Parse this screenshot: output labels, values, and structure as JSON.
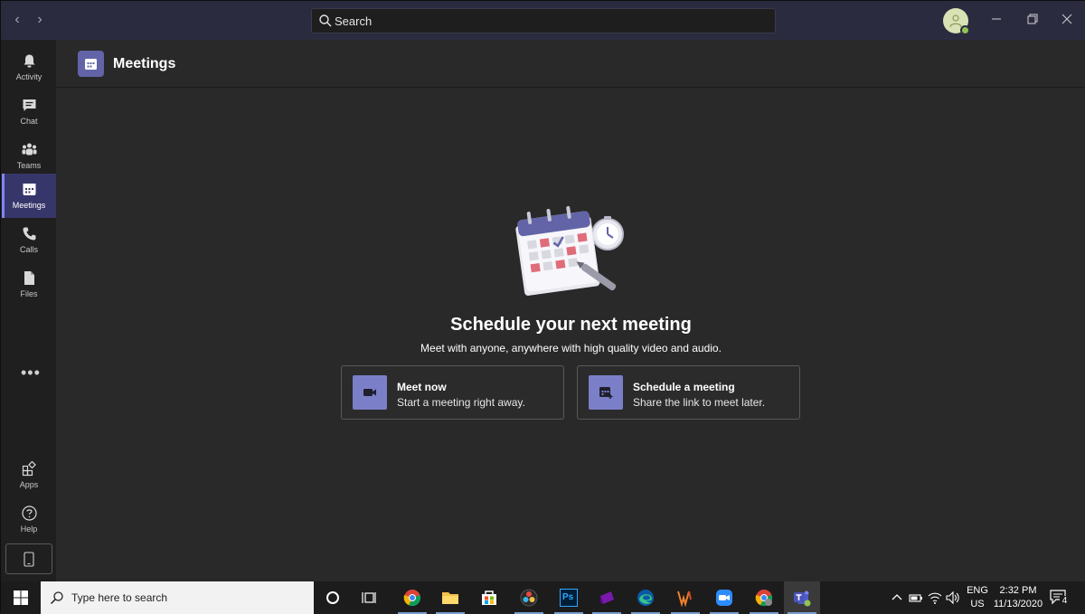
{
  "titlebar": {
    "search_label": "Search",
    "back_icon": "chevron-left-icon",
    "forward_icon": "chevron-right-icon",
    "minimize_icon": "minimize-icon",
    "restore_icon": "restore-icon",
    "close_icon": "close-icon"
  },
  "rail": {
    "items": [
      {
        "label": "Activity",
        "icon": "bell-icon"
      },
      {
        "label": "Chat",
        "icon": "chat-icon"
      },
      {
        "label": "Teams",
        "icon": "teams-icon"
      },
      {
        "label": "Meetings",
        "icon": "calendar-icon",
        "active": true
      },
      {
        "label": "Calls",
        "icon": "phone-icon"
      },
      {
        "label": "Files",
        "icon": "file-icon"
      }
    ],
    "more_label": "•••",
    "bottom": [
      {
        "label": "Apps",
        "icon": "apps-icon"
      },
      {
        "label": "Help",
        "icon": "help-icon"
      }
    ]
  },
  "header": {
    "title": "Meetings"
  },
  "empty_state": {
    "headline": "Schedule your next meeting",
    "subline": "Meet with anyone, anywhere with high quality video and audio."
  },
  "cards": [
    {
      "title": "Meet now",
      "subtitle": "Start a meeting right away.",
      "icon": "video-camera-icon"
    },
    {
      "title": "Schedule a meeting",
      "subtitle": "Share the link to meet later.",
      "icon": "calendar-add-icon"
    }
  ],
  "taskbar": {
    "search_placeholder": "Type here to search",
    "apps": [
      "chrome",
      "file-explorer",
      "store",
      "davinci-resolve",
      "photoshop",
      "onenote",
      "edge",
      "winamp",
      "zoom",
      "chrome-profile",
      "teams"
    ],
    "ps_label": "Ps",
    "lang_top": "ENG",
    "lang_bottom": "US",
    "time": "2:32 PM",
    "date": "11/13/2020",
    "notification_count": "4"
  },
  "colors": {
    "accent": "#6264a7",
    "accent_light": "#7f85f5",
    "titlebar": "#2b2b40",
    "background": "#292929",
    "presence": "#92c353"
  }
}
